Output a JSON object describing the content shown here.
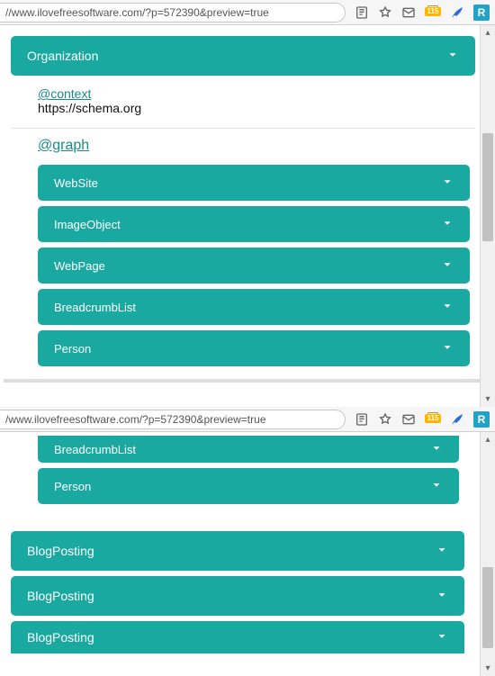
{
  "url": "//www.ilovefreesoftware.com/?p=572390&preview=true",
  "url2": "/www.ilovefreesoftware.com/?p=572390&preview=true",
  "toolbar": {
    "badge": "115",
    "ext_letter": "R"
  },
  "pane1": {
    "top_item": {
      "label": "Organization"
    },
    "context_key": "@context",
    "context_value": "https://schema.org",
    "graph_key": "@graph",
    "graph_items": [
      {
        "label": "WebSite"
      },
      {
        "label": "ImageObject"
      },
      {
        "label": "WebPage"
      },
      {
        "label": "BreadcrumbList"
      },
      {
        "label": "Person"
      }
    ]
  },
  "pane2": {
    "nested_items": [
      {
        "label": "BreadcrumbList"
      },
      {
        "label": "Person"
      }
    ],
    "outer_items": [
      {
        "label": "BlogPosting"
      },
      {
        "label": "BlogPosting"
      },
      {
        "label": "BlogPosting"
      }
    ]
  }
}
